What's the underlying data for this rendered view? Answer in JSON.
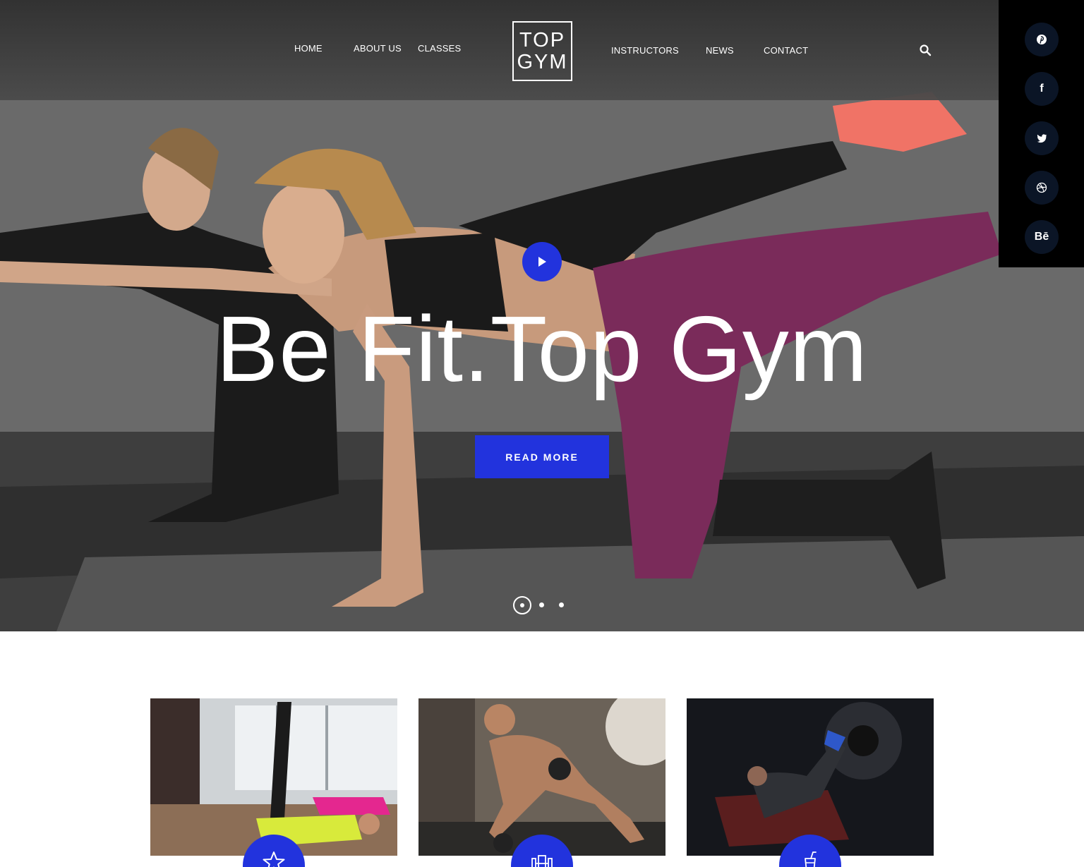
{
  "nav": {
    "left": [
      {
        "label": "HOME"
      },
      {
        "label": "ABOUT US"
      },
      {
        "label": "CLASSES"
      }
    ],
    "right": [
      {
        "label": "INSTRUCTORS"
      },
      {
        "label": "NEWS"
      },
      {
        "label": "CONTACT"
      }
    ],
    "search_icon": "search-icon"
  },
  "logo": {
    "line1": "TOP",
    "line2": "GYM"
  },
  "social": [
    {
      "icon": "pinterest-icon"
    },
    {
      "icon": "facebook-icon",
      "text": "f"
    },
    {
      "icon": "twitter-icon"
    },
    {
      "icon": "dribbble-icon"
    },
    {
      "icon": "behance-icon",
      "text": "Bē"
    }
  ],
  "hero": {
    "title": "Be Fit.Top Gym",
    "button_label": "READ MORE",
    "play_icon": "play-icon",
    "slides": {
      "count": 3,
      "active": 1
    }
  },
  "cards": [
    {
      "image": "pilates-reformer-photo",
      "icon": "star-icon"
    },
    {
      "image": "dumbbell-pushup-photo",
      "icon": "gym-equipment-icon"
    },
    {
      "image": "leg-press-photo",
      "icon": "drink-cup-icon"
    }
  ],
  "colors": {
    "accent": "#2233dd",
    "social_panel": "#000000",
    "social_button": "#0b1526",
    "header": "#3a3a3a"
  }
}
